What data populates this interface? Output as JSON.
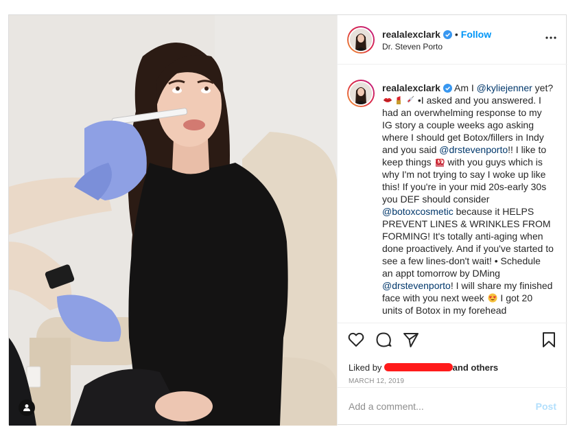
{
  "header": {
    "username": "realalexclark",
    "separator": "•",
    "follow_label": "Follow",
    "location": "Dr. Steven Porto"
  },
  "caption": {
    "username": "realalexclark",
    "t1": "Am I ",
    "m1": "@kyliejenner",
    "t2": " yet? ",
    "t3": " •I asked and you answered. I had an overwhelming response to my IG story a couple weeks ago asking where I should get Botox/fillers in Indy and you said ",
    "m2": "@drstevenporto",
    "t4": "!! I like to keep things ",
    "t5": " with you guys which is why I'm not trying to say I woke up like this! If you're in your mid 20s-early 30s you DEF should consider ",
    "m3": "@botoxcosmetic",
    "t6": " because it HELPS PREVENT LINES & WRINKLES FROM FORMING! It's totally anti-aging when done proactively. And if you've started to see a few lines-don't wait! • Schedule an appt tomorrow by DMing ",
    "m4": "@drstevenporto",
    "t7": "! I will share my finished face with you next week ",
    "t8": " I got 20 units of Botox in my forehead"
  },
  "actions": {
    "liked_by_prefix": "Liked by",
    "liked_by_suffix": "and others",
    "date": "MARCH 12, 2019"
  },
  "comment": {
    "placeholder": "Add a comment...",
    "post_label": "Post"
  },
  "icons": {
    "more": "more-options-icon",
    "like": "heart-icon",
    "comment": "comment-icon",
    "share": "share-icon",
    "save": "bookmark-icon",
    "tag": "user-tag-icon"
  },
  "colors": {
    "follow": "#0095f6",
    "mention": "#00376b",
    "post_disabled": "#b2dffc",
    "verified": "#3897f0",
    "redaction": "#ff1b1b"
  }
}
